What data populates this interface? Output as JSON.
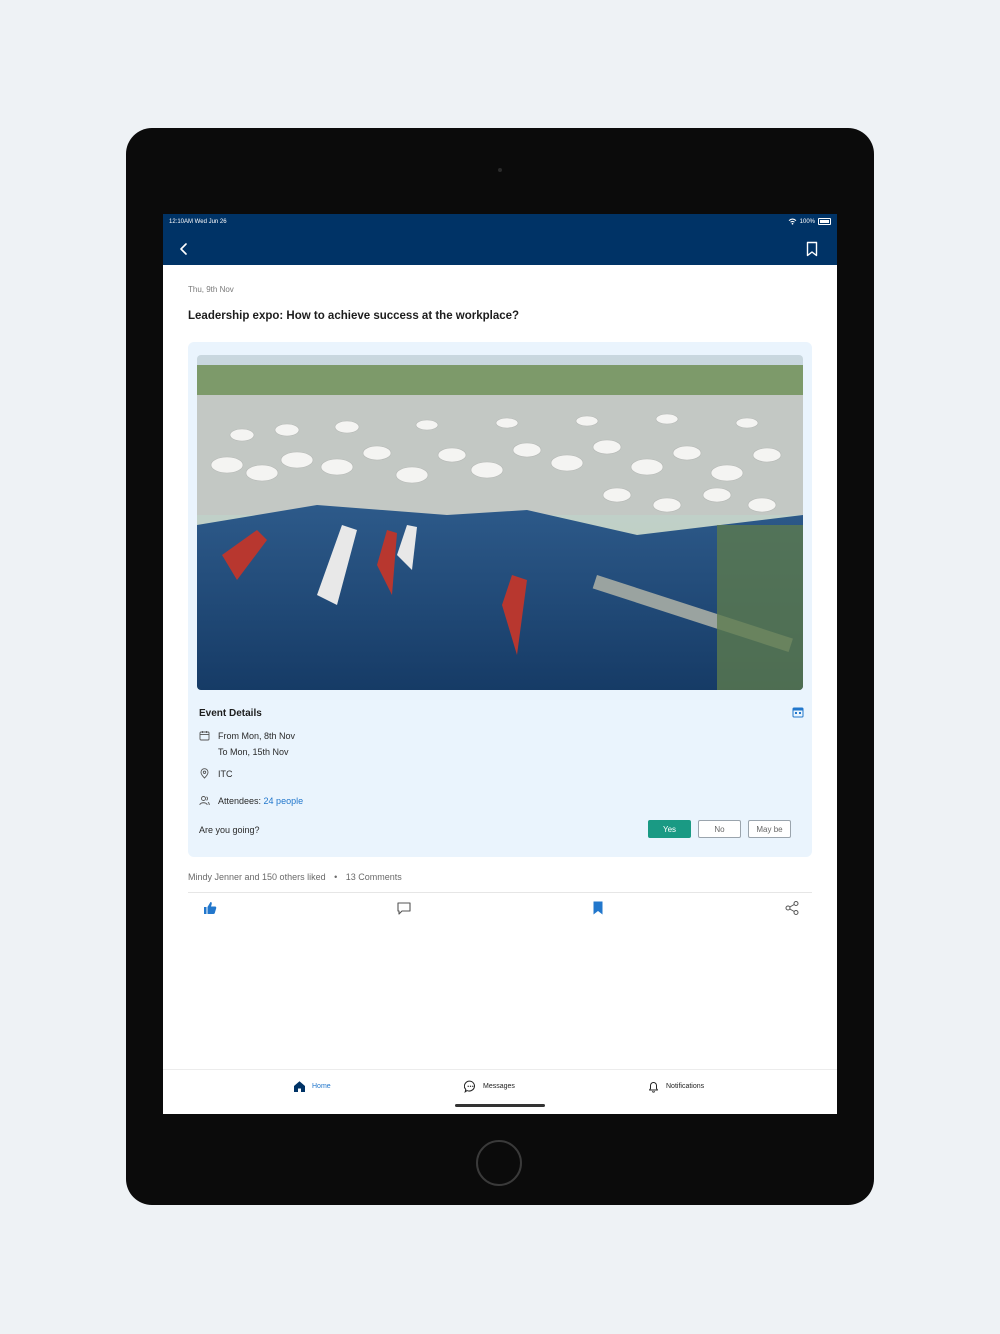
{
  "status_bar": {
    "time": "12:10AM Wed Jun 26",
    "battery": "100%"
  },
  "post": {
    "date": "Thu, 9th Nov",
    "title": "Leadership expo: How to achieve success at the workplace?"
  },
  "event": {
    "heading": "Event Details",
    "from": "From Mon, 8th Nov",
    "to": "To Mon, 15th Nov",
    "location": "ITC",
    "attendees_label": "Attendees:",
    "attendees_value": "24 people",
    "question": "Are you going?",
    "rsvp": {
      "yes": "Yes",
      "no": "No",
      "maybe": "May be"
    }
  },
  "engagement": {
    "likes": "Mindy Jenner and 150 others liked",
    "separator": "•",
    "comments": "13 Comments"
  },
  "bottom_nav": {
    "home": "Home",
    "messages": "Messages",
    "notifications": "Notifications"
  },
  "colors": {
    "header": "#003366",
    "accent": "#2277cc",
    "yes_button": "#1a9a84",
    "card_bg": "#eaf4fd"
  },
  "icons": [
    "back-icon",
    "bookmark-icon",
    "calendar-icon",
    "location-pin-icon",
    "people-icon",
    "thumbs-up-icon",
    "comment-icon",
    "share-icon",
    "home-icon",
    "messages-icon",
    "bell-icon"
  ]
}
